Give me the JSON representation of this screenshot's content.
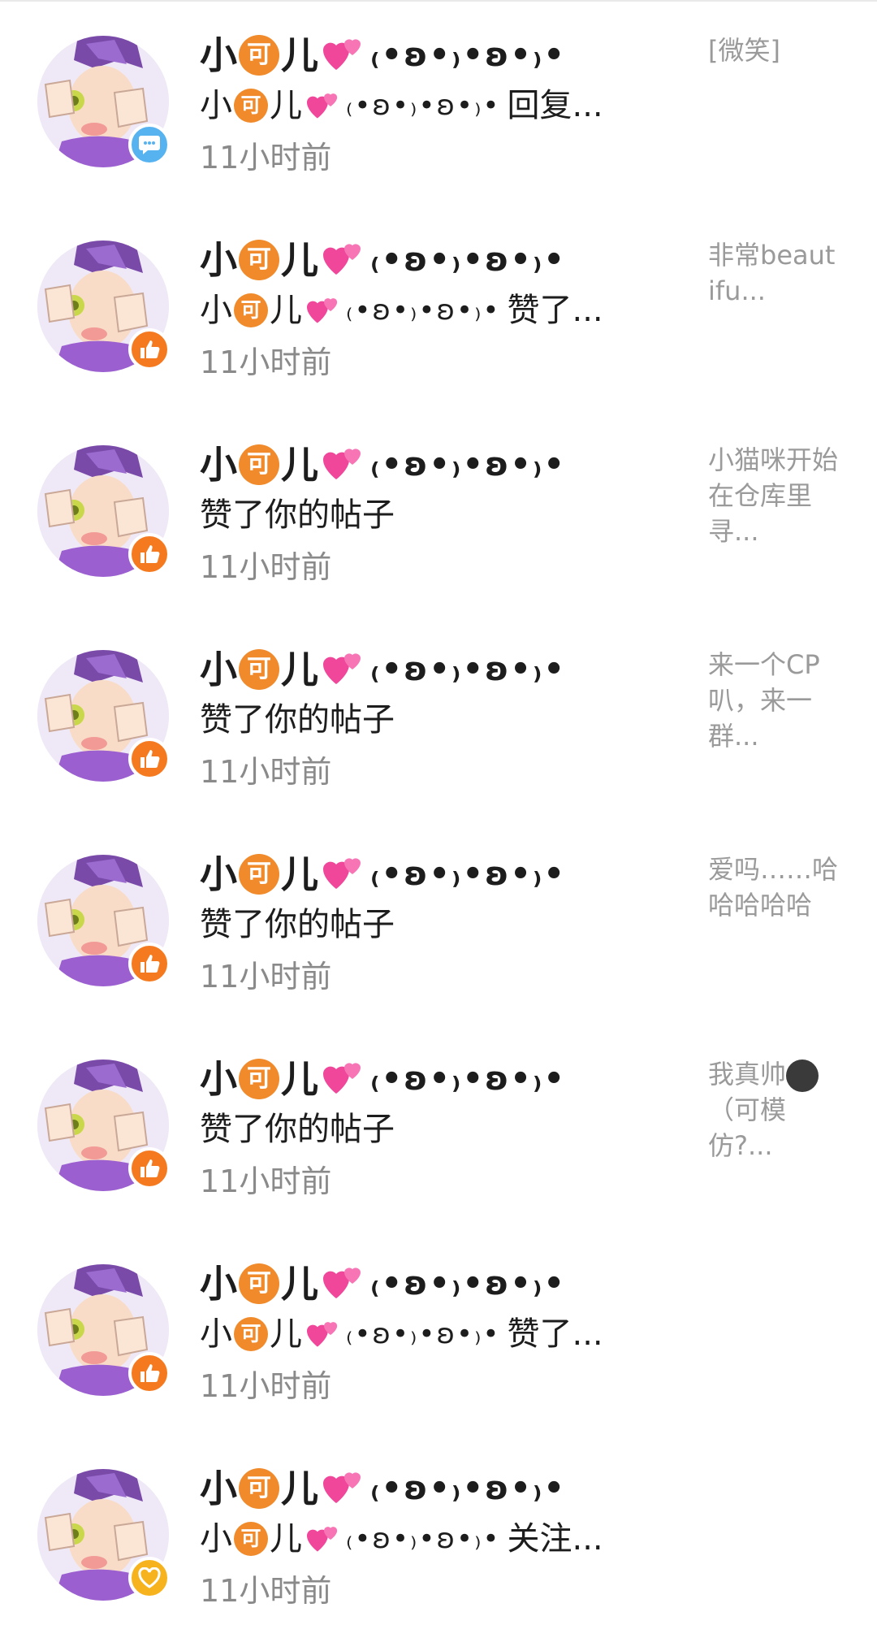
{
  "colors": {
    "comment_badge": "#56b3f0",
    "like_badge": "#f57a1f",
    "follow_badge": "#f7b31d",
    "name_text": "#1d1d1d",
    "secondary_text": "#8a8a8a",
    "preview_text": "#9a9a9a"
  },
  "user": {
    "name_part1": "小",
    "name_badge": "可",
    "name_part2": "儿",
    "name_emoji": "heart-emoji",
    "name_kaomoji": "₍•ʚ•₎•ʚ•₎•"
  },
  "notifications": [
    {
      "type": "comment",
      "icon": "comment-icon",
      "action_text": "回复...",
      "time": "11小时前",
      "preview": "[微笑]"
    },
    {
      "type": "like",
      "icon": "thumbs-up-icon",
      "action_text": "赞了...",
      "time": "11小时前",
      "preview": "非常beautifu..."
    },
    {
      "type": "like",
      "icon": "thumbs-up-icon",
      "action_text": "赞了你的帖子",
      "time": "11小时前",
      "preview": "小猫咪开始在仓库里寻..."
    },
    {
      "type": "like",
      "icon": "thumbs-up-icon",
      "action_text": "赞了你的帖子",
      "time": "11小时前",
      "preview": "来一个CP叭，来一群..."
    },
    {
      "type": "like",
      "icon": "thumbs-up-icon",
      "action_text": "赞了你的帖子",
      "time": "11小时前",
      "preview": "爱吗……哈哈哈哈哈"
    },
    {
      "type": "like",
      "icon": "thumbs-up-icon",
      "action_text": "赞了你的帖子",
      "time": "11小时前",
      "preview": "我真帅",
      "preview_emoji": "dark-smile-emoji",
      "preview_tail": "（可模仿?..."
    },
    {
      "type": "like",
      "icon": "thumbs-up-icon",
      "action_text": "赞了...",
      "time": "11小时前",
      "preview": ""
    },
    {
      "type": "follow",
      "icon": "heart-icon",
      "action_text": "关注...",
      "time": "11小时前",
      "preview": ""
    }
  ]
}
